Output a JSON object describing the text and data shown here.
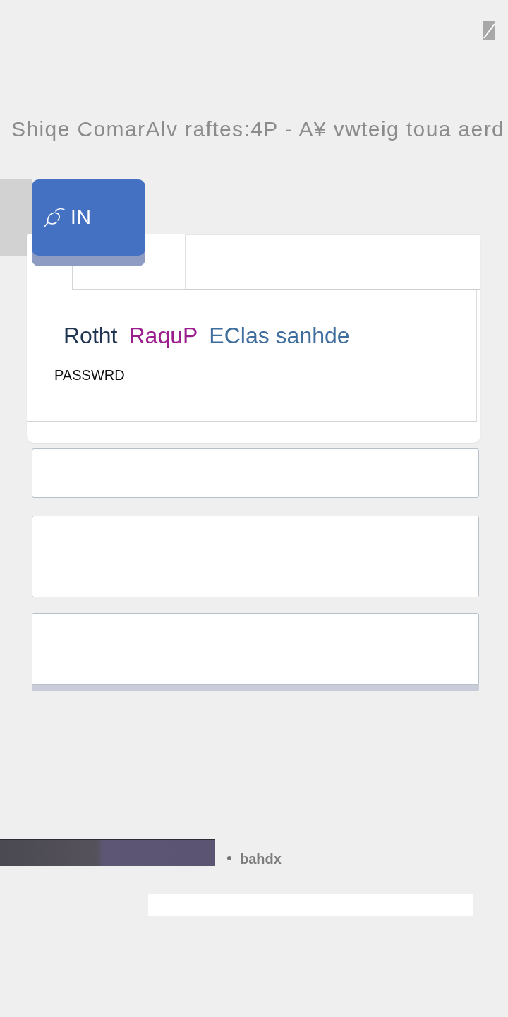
{
  "headline": "Shiqe ComarAlv raftes:4P - A¥ vwteig toua aerd",
  "sign_in_button": {
    "label": "IN"
  },
  "card": {
    "title_parts": [
      {
        "text": "Rotht",
        "color": "#1f3552"
      },
      {
        "text": "RaquP",
        "color": "#9b1c8c"
      },
      {
        "text": "EClas sanhde",
        "color": "#3e6d9e"
      }
    ],
    "label": "PASSWRD"
  },
  "footer": {
    "caption": "bahdx"
  }
}
